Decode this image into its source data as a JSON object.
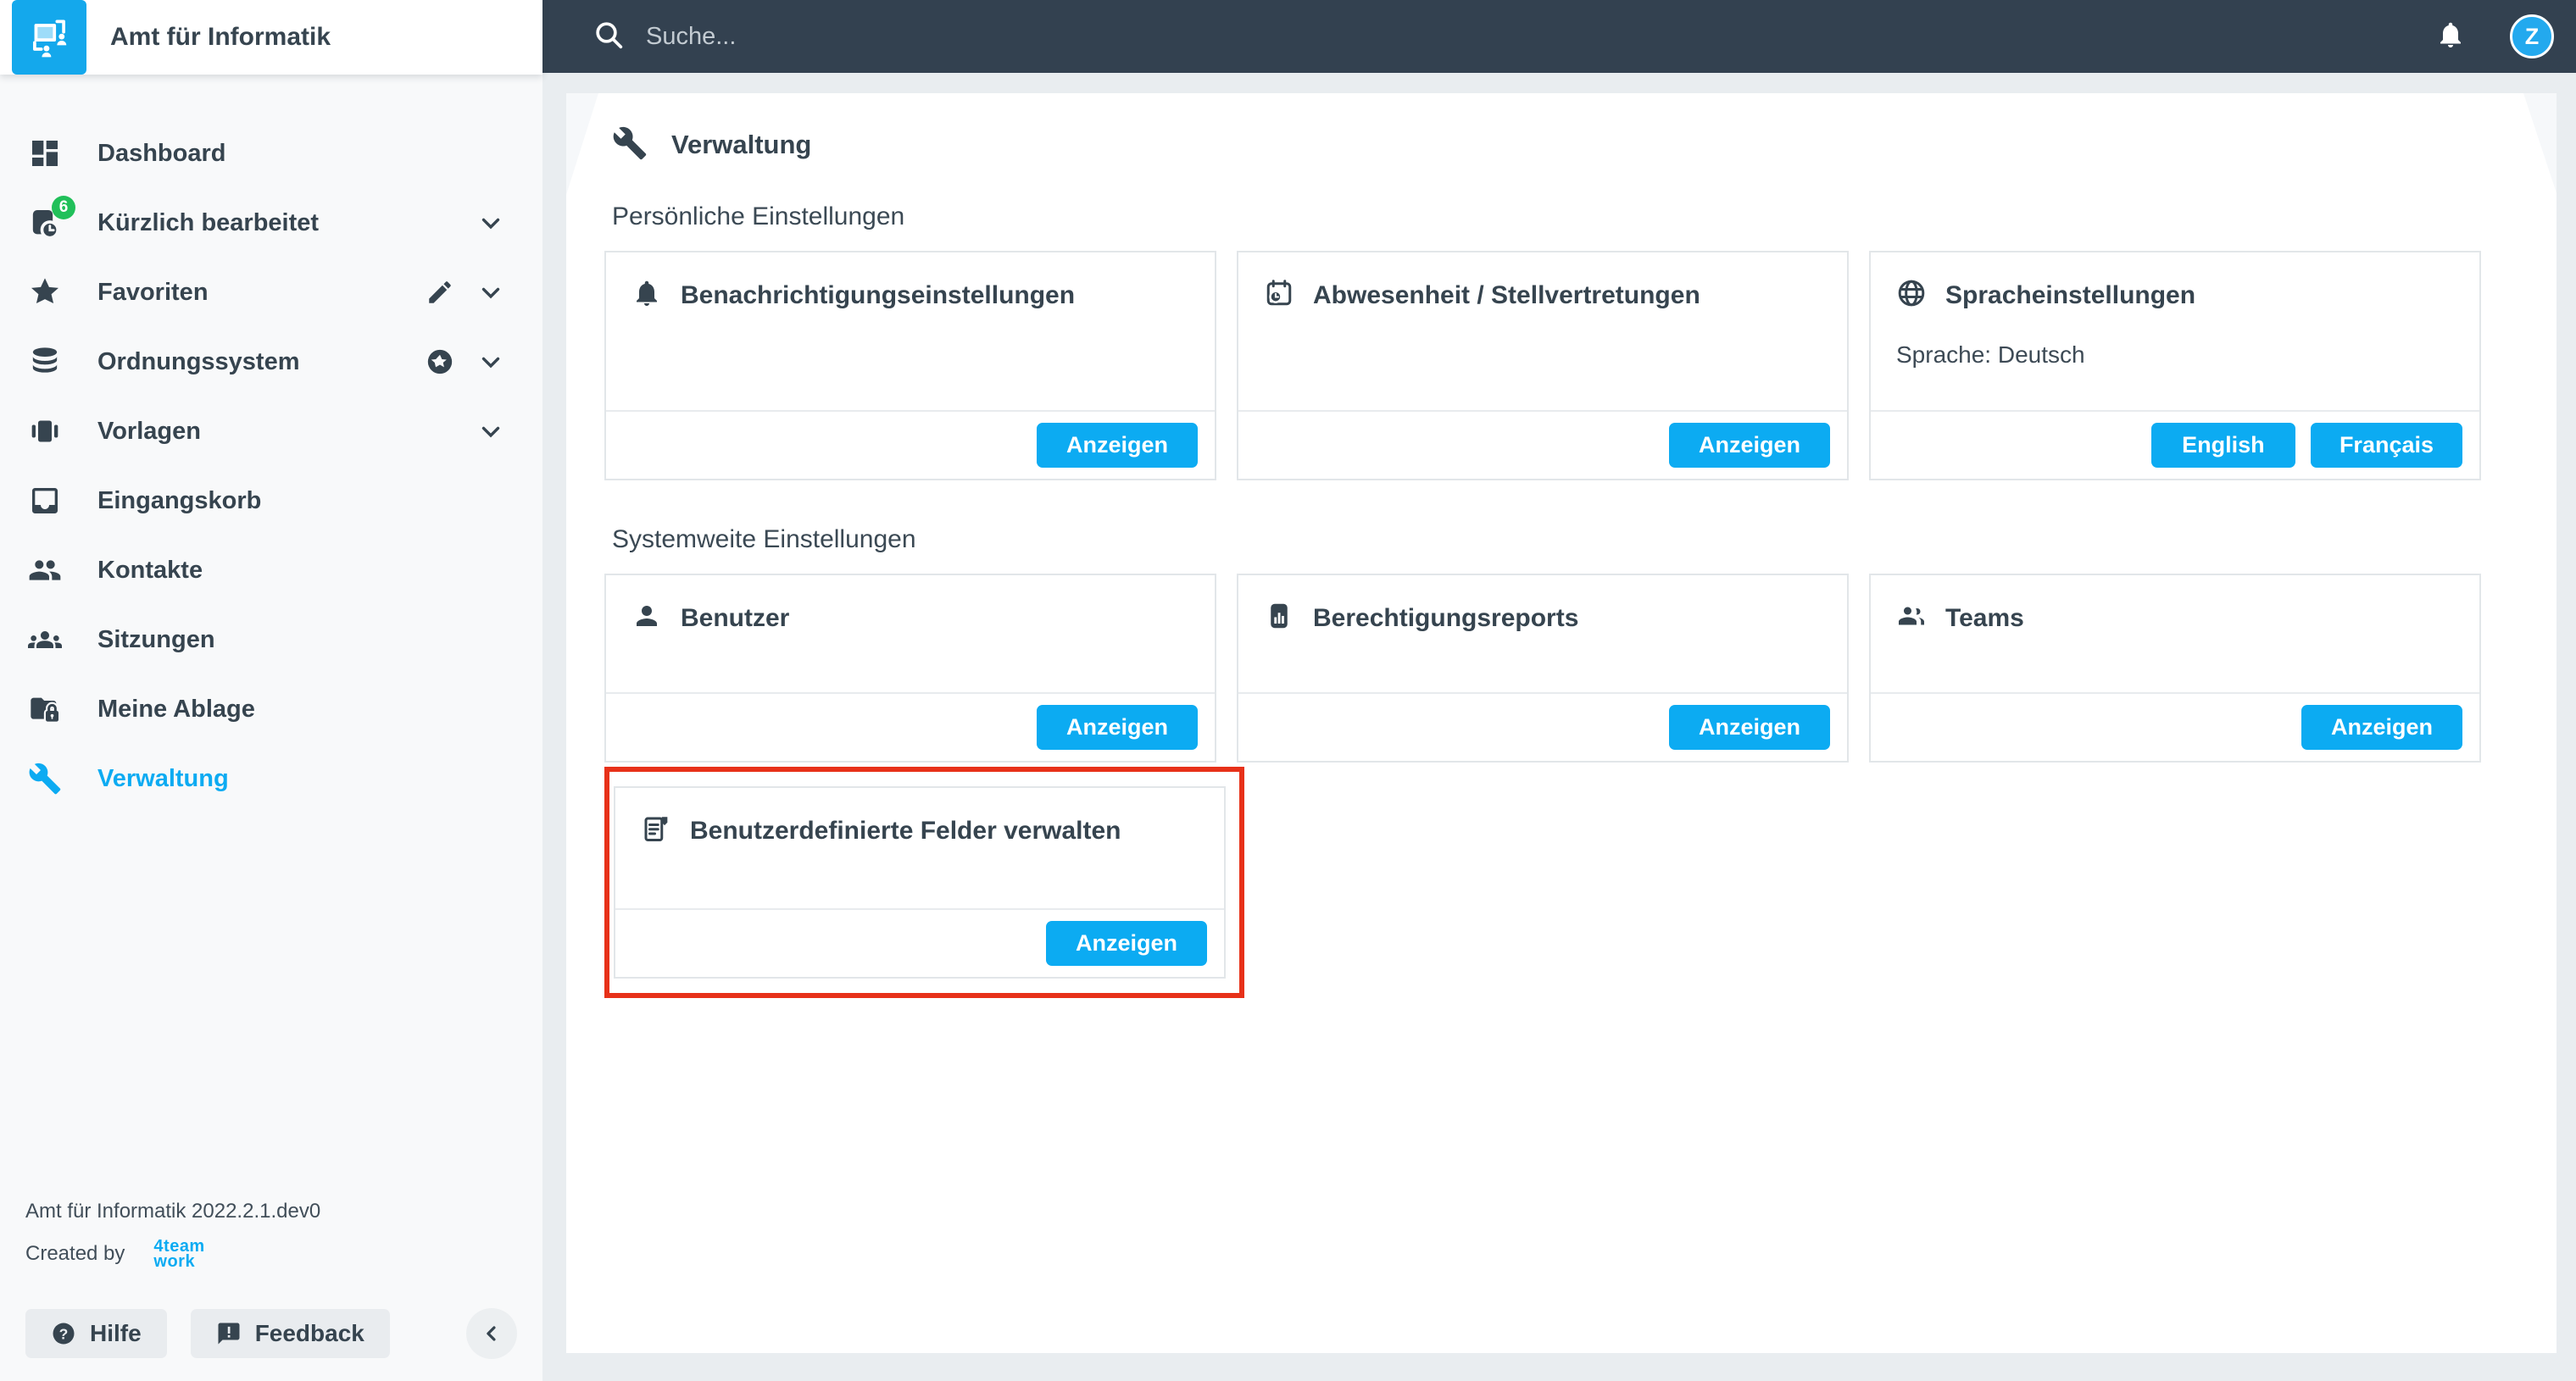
{
  "theme": {
    "accent": "#0cabf2",
    "topbar": "#334150",
    "dark": "#36444f",
    "bg": "#e9edf0",
    "sidebar_bg": "#f8f9fa",
    "card_border": "#e2e6e9",
    "highlight": "#e73119",
    "badge_green": "#21c05a",
    "logo_blue": "#14a8ec",
    "avatar_blue": "#23a9ee"
  },
  "sidebar": {
    "app_title": "Amt für Informatik",
    "items": [
      {
        "label": "Dashboard",
        "icon": "dashboard-grid-icon"
      },
      {
        "label": "Kürzlich bearbeitet",
        "icon": "recent-document-clock-icon",
        "badge": "6",
        "chevron": true
      },
      {
        "label": "Favoriten",
        "icon": "star-icon",
        "edit": true,
        "chevron": true
      },
      {
        "label": "Ordnungssystem",
        "icon": "database-icon",
        "starred": true,
        "chevron": true
      },
      {
        "label": "Vorlagen",
        "icon": "templates-carousel-icon",
        "chevron": true
      },
      {
        "label": "Eingangskorb",
        "icon": "inbox-icon"
      },
      {
        "label": "Kontakte",
        "icon": "contacts-people-icon"
      },
      {
        "label": "Sitzungen",
        "icon": "meetings-group-icon"
      },
      {
        "label": "Meine Ablage",
        "icon": "folder-lock-icon"
      },
      {
        "label": "Verwaltung",
        "icon": "wrench-icon",
        "active": true
      }
    ],
    "footer": {
      "version": "Amt für Informatik 2022.2.1.dev0",
      "created_by": "Created by",
      "brand_line1": "4team",
      "brand_line2": "work",
      "help_label": "Hilfe",
      "feedback_label": "Feedback"
    }
  },
  "topbar": {
    "search_placeholder": "Suche...",
    "avatar_initial": "Z"
  },
  "main": {
    "page_title": "Verwaltung",
    "sections": [
      {
        "heading": "Persönliche Einstellungen",
        "cards": [
          {
            "icon": "bell-icon",
            "title": "Benachrichtigungseinstellungen",
            "action": "Anzeigen"
          },
          {
            "icon": "calendar-clock-icon",
            "title": "Abwesenheit / Stellvertretungen",
            "action": "Anzeigen"
          },
          {
            "icon": "globe-icon",
            "title": "Spracheinstellungen",
            "body": "Sprache: Deutsch",
            "actions": [
              "English",
              "Français"
            ]
          }
        ]
      },
      {
        "heading": "Systemweite Einstellungen",
        "cards": [
          {
            "icon": "user-icon",
            "title": "Benutzer",
            "action": "Anzeigen"
          },
          {
            "icon": "report-chart-icon",
            "title": "Berechtigungsreports",
            "action": "Anzeigen"
          },
          {
            "icon": "teams-people-icon",
            "title": "Teams",
            "action": "Anzeigen"
          }
        ]
      }
    ],
    "highlighted_card": {
      "icon": "custom-fields-form-icon",
      "title": "Benutzerdefinierte Felder verwalten",
      "action": "Anzeigen"
    }
  }
}
